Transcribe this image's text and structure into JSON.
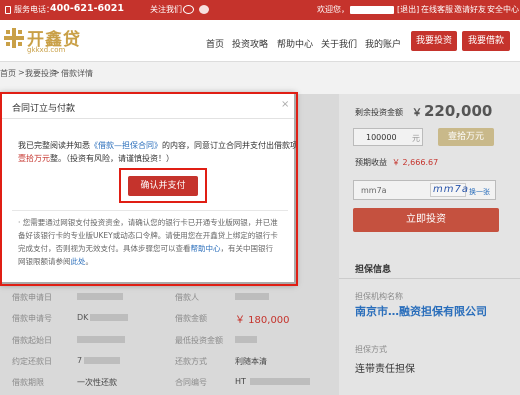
{
  "topbar": {
    "service_label": "服务电话：",
    "phone": "400-621-6021",
    "follow_label": "关注我们",
    "welcome": "欢迎您，",
    "logout": "[退出]",
    "online_service": "在线客服",
    "invite_friends": "邀请好友",
    "safety_center": "安全中心",
    "weibo_icon": "weibo-icon",
    "wechat_icon": "wechat-icon"
  },
  "header": {
    "logo_text": "开鑫贷",
    "logo_domain": "gkkxd.com",
    "nav": [
      "首页",
      "投资攻略",
      "帮助中心",
      "关于我们",
      "我的账户"
    ],
    "btn_invest": "我要投资",
    "btn_borrow": "我要借款",
    "colors": {
      "brand_red": "#c5332c",
      "logo_gold": "#c9a047"
    }
  },
  "breadcrumb": [
    "首页",
    "我要投资",
    "借款详情"
  ],
  "right_panel": {
    "remaining_label": "剩余投资金额",
    "remaining_currency": "￥",
    "remaining_amount": "220,000",
    "input_value": "100000",
    "input_unit": "元",
    "btn_wan": "壹拾万元",
    "expected_label": "预期收益",
    "expected_value": "￥ 2,666.67",
    "captcha_value": "mm7a",
    "captcha_image_text": "mm7a",
    "captcha_refresh": "换一张",
    "btn_invest_now": "立即投资",
    "guarantee_title": "担保信息",
    "guarantee_org_label": "担保机构名称",
    "guarantee_org_name": "南京市…融资担保有限公司",
    "guarantee_method_label": "担保方式",
    "guarantee_method": "连带责任担保"
  },
  "left_table": {
    "rows": [
      {
        "l1": "借款申请日",
        "l2": "借款人"
      },
      {
        "l1": "借款申请号",
        "v1": "DK",
        "l2": "借款金额",
        "v2": "￥ 180,000"
      },
      {
        "l1": "借款起始日",
        "l2": "最低投资金额"
      },
      {
        "l1": "约定还款日",
        "v1": "7",
        "l2": "还款方式",
        "v2": "利随本清"
      },
      {
        "l1": "借款期限",
        "v1": "一次性还款",
        "l2": "合同编号",
        "v2": "HT"
      }
    ]
  },
  "modal": {
    "title": "合同订立与付款",
    "close": "×",
    "line1_pre": "我已完整阅读并知悉",
    "line1_link": "《借款—担保合同》",
    "line1_post": "的内容，同意订立合同并支付出借款项",
    "line2_amount": "壹拾万元",
    "line2_post": "整。（投资有风险，请谨慎投资！）",
    "confirm": "确认并支付",
    "note_lines": [
      "· 您需要通过网银支付投资资金，请确认您的银行卡已开通专业版网银，并已准",
      "备好该银行卡的专业版UKEY或动态口令牌。请使用您在开鑫贷上绑定的银行卡",
      "完成支付，否则视为无效支付。具体步骤您可以查看",
      "网银限额请参阅"
    ],
    "note_help_link": "帮助中心",
    "note_help_post": "，有关中国银行",
    "note_here_link": "此处",
    "note_end": "。"
  }
}
